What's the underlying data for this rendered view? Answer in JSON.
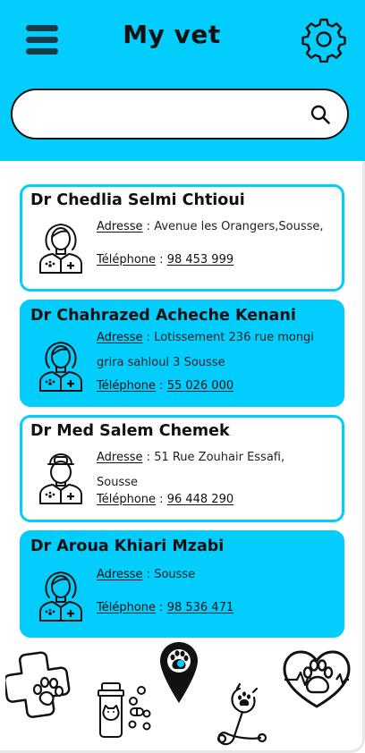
{
  "header": {
    "title": "My vet",
    "menu_icon": "hamburger-menu-icon",
    "settings_icon": "gear-icon"
  },
  "search": {
    "value": "",
    "placeholder": "",
    "icon": "search-icon"
  },
  "labels": {
    "address": "Adresse",
    "phone": "Téléphone",
    "separator": " : "
  },
  "vets": [
    {
      "name": "Dr Chedlia Selmi Chtioui",
      "address_line1": "Avenue les Orangers,Sousse,",
      "address_line2": "",
      "phone": "98 453 999",
      "avatar": "female-vet-avatar-icon"
    },
    {
      "name": "Dr Chahrazed Acheche Kenani",
      "address_line1": "Lotissement 236 rue mongi",
      "address_line2": "grira sahloul 3 Sousse",
      "phone": "55 026 000",
      "avatar": "female-vet-avatar-icon"
    },
    {
      "name": "Dr Med Salem Chemek",
      "address_line1": "51 Rue Zouhair Essafi,",
      "address_line2": "Sousse",
      "phone": "96 448 290",
      "avatar": "male-vet-avatar-icon"
    },
    {
      "name": "Dr Aroua Khiari Mzabi",
      "address_line1": "Sousse",
      "address_line2": "",
      "phone": "98 536 471",
      "avatar": "female-vet-avatar-icon"
    }
  ],
  "bottom_nav": [
    "vet-cross-paw-icon",
    "pet-medicine-icon",
    "vet-location-pin-icon",
    "stethoscope-icon",
    "heart-paw-icon"
  ],
  "colors": {
    "accent": "#02CDFD",
    "text": "#111111",
    "background": "#FFFFFF"
  }
}
